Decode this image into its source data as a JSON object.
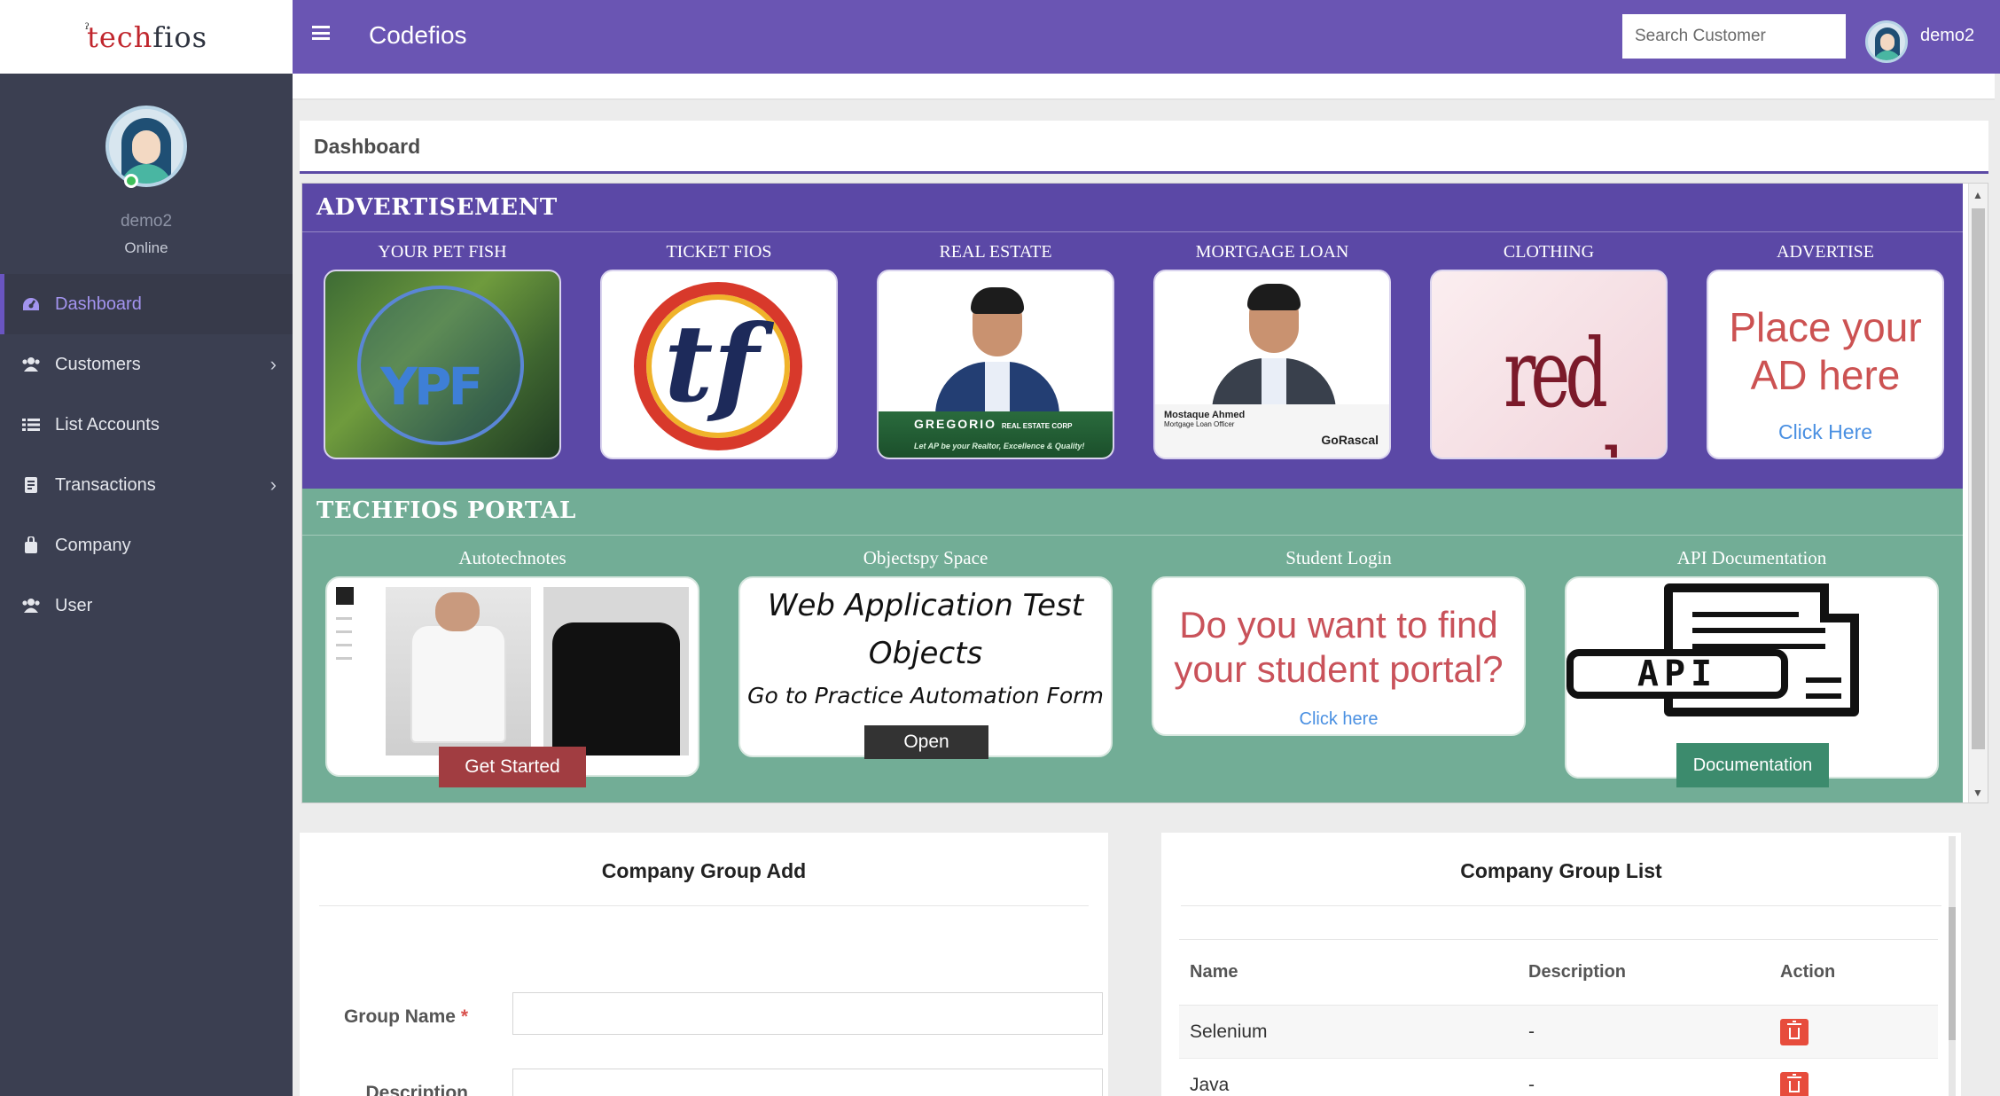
{
  "logo": {
    "prefix": "ˀ",
    "tech": "tech",
    "fios": "fios"
  },
  "header": {
    "brand": "Codefios",
    "search_placeholder": "Search Customer",
    "user": "demo2"
  },
  "profile": {
    "name": "demo2",
    "status": "Online"
  },
  "sidebar": {
    "items": [
      {
        "label": "Dashboard",
        "icon": "dashboard-icon"
      },
      {
        "label": "Customers",
        "icon": "users-icon"
      },
      {
        "label": "List Accounts",
        "icon": "list-icon"
      },
      {
        "label": "Transactions",
        "icon": "receipt-icon"
      },
      {
        "label": "Company",
        "icon": "briefcase-icon"
      },
      {
        "label": "User",
        "icon": "users-icon"
      }
    ]
  },
  "page": {
    "title": "Dashboard"
  },
  "advertisement": {
    "heading": "ADVERTISEMENT",
    "cards": [
      {
        "label": "YOUR PET FISH",
        "art": "YPF"
      },
      {
        "label": "TICKET FIOS",
        "art": "tf"
      },
      {
        "label": "REAL ESTATE",
        "brand": "GREGORIO",
        "brand_sub": "REAL ESTATE CORP",
        "tagline": "Let AP be your Realtor, Excellence & Quality!"
      },
      {
        "label": "MORTGAGE LOAN",
        "person": "Mostaque Ahmed",
        "role": "Mortgage Loan Officer",
        "brand": "GoRascal"
      },
      {
        "label": "CLOTHING",
        "art": "red yard"
      },
      {
        "label": "ADVERTISE",
        "line1": "Place your",
        "line2": "AD here",
        "link": "Click Here"
      }
    ]
  },
  "portal": {
    "heading": "TECHFIOS PORTAL",
    "cards": [
      {
        "label": "Autotechnotes",
        "button": "Get Started"
      },
      {
        "label": "Objectspy Space",
        "line1": "Web Application Test",
        "line2": "Objects",
        "sub": "Go to Practice Automation Form",
        "button": "Open"
      },
      {
        "label": "Student Login",
        "line1": "Do you want to find",
        "line2": "your student portal?",
        "link": "Click here"
      },
      {
        "label": "API Documentation",
        "art": "API",
        "button": "Documentation"
      }
    ]
  },
  "group_add": {
    "title": "Company Group Add",
    "name_label": "Group Name",
    "required_mark": "*",
    "description_label": "Description"
  },
  "group_list": {
    "title": "Company Group List",
    "columns": [
      "Name",
      "Description",
      "Action"
    ],
    "rows": [
      {
        "name": "Selenium",
        "description": "-"
      },
      {
        "name": "Java",
        "description": "-"
      }
    ]
  },
  "colors": {
    "topbar": "#6a55b3",
    "sidebar": "#3b3f51",
    "advert": "#5b48a6",
    "portal": "#72ad96",
    "delete": "#e74c3c"
  }
}
